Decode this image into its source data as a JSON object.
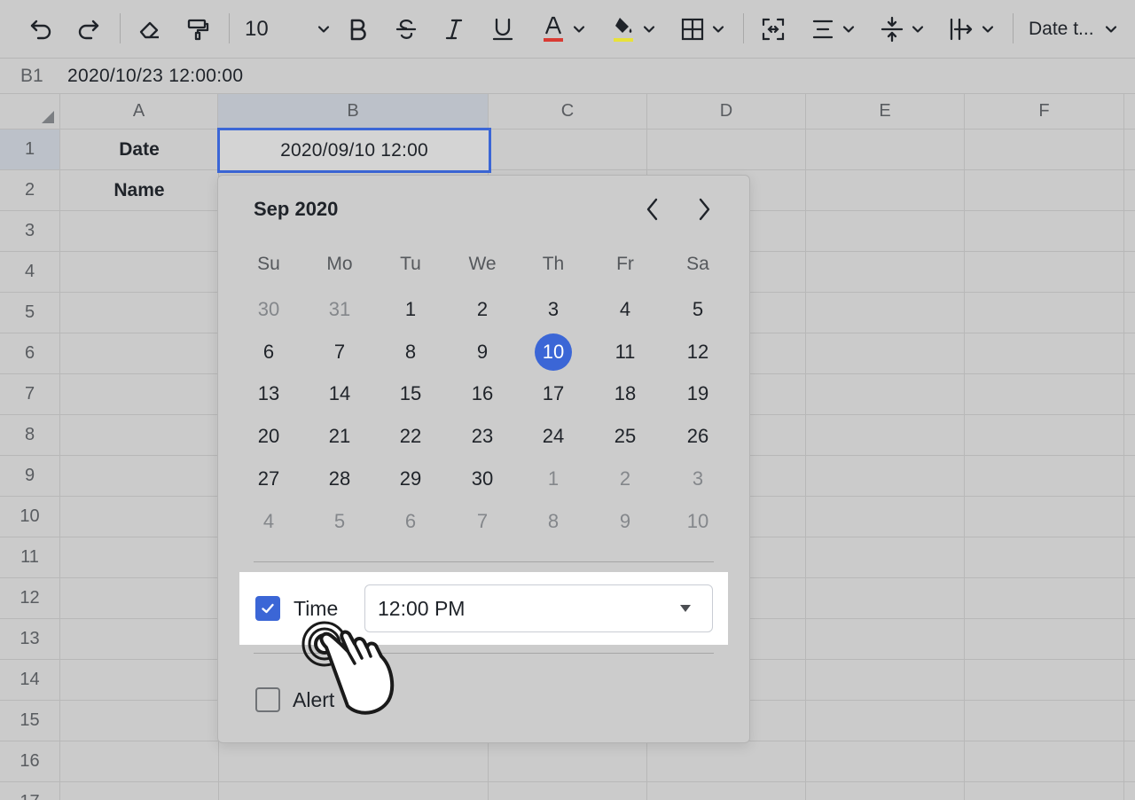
{
  "toolbar": {
    "font_size": "10",
    "number_format": "Date t...",
    "font_color": "#d93b33",
    "fill_color": "#e8e23a"
  },
  "formula_bar": {
    "cell_ref": "B1",
    "value": "2020/10/23 12:00:00"
  },
  "sheet": {
    "columns": [
      "A",
      "B",
      "C",
      "D",
      "E",
      "F"
    ],
    "rows": [
      "1",
      "2",
      "3",
      "4",
      "5",
      "6",
      "7",
      "8",
      "9",
      "10",
      "11",
      "12",
      "13",
      "14",
      "15",
      "16",
      "17"
    ],
    "cells": {
      "A1": "Date",
      "A2": "Name",
      "B1": "2020/09/10 12:00"
    }
  },
  "date_picker": {
    "month_label": "Sep 2020",
    "weekdays": [
      "Su",
      "Mo",
      "Tu",
      "We",
      "Th",
      "Fr",
      "Sa"
    ],
    "weeks": [
      [
        {
          "d": "30",
          "m": true
        },
        {
          "d": "31",
          "m": true
        },
        {
          "d": "1"
        },
        {
          "d": "2"
        },
        {
          "d": "3"
        },
        {
          "d": "4"
        },
        {
          "d": "5"
        }
      ],
      [
        {
          "d": "6"
        },
        {
          "d": "7"
        },
        {
          "d": "8"
        },
        {
          "d": "9"
        },
        {
          "d": "10",
          "sel": true
        },
        {
          "d": "11"
        },
        {
          "d": "12"
        }
      ],
      [
        {
          "d": "13"
        },
        {
          "d": "14"
        },
        {
          "d": "15"
        },
        {
          "d": "16"
        },
        {
          "d": "17"
        },
        {
          "d": "18"
        },
        {
          "d": "19"
        }
      ],
      [
        {
          "d": "20"
        },
        {
          "d": "21"
        },
        {
          "d": "22"
        },
        {
          "d": "23"
        },
        {
          "d": "24"
        },
        {
          "d": "25"
        },
        {
          "d": "26"
        }
      ],
      [
        {
          "d": "27"
        },
        {
          "d": "28"
        },
        {
          "d": "29"
        },
        {
          "d": "30"
        },
        {
          "d": "1",
          "m": true
        },
        {
          "d": "2",
          "m": true
        },
        {
          "d": "3",
          "m": true
        }
      ],
      [
        {
          "d": "4",
          "m": true
        },
        {
          "d": "5",
          "m": true
        },
        {
          "d": "6",
          "m": true
        },
        {
          "d": "7",
          "m": true
        },
        {
          "d": "8",
          "m": true
        },
        {
          "d": "9",
          "m": true
        },
        {
          "d": "10",
          "m": true
        }
      ]
    ],
    "time_label": "Time",
    "time_checked": true,
    "time_value": "12:00 PM",
    "alert_label": "Alert",
    "alert_checked": false,
    "accent_color": "#3b66d6"
  }
}
